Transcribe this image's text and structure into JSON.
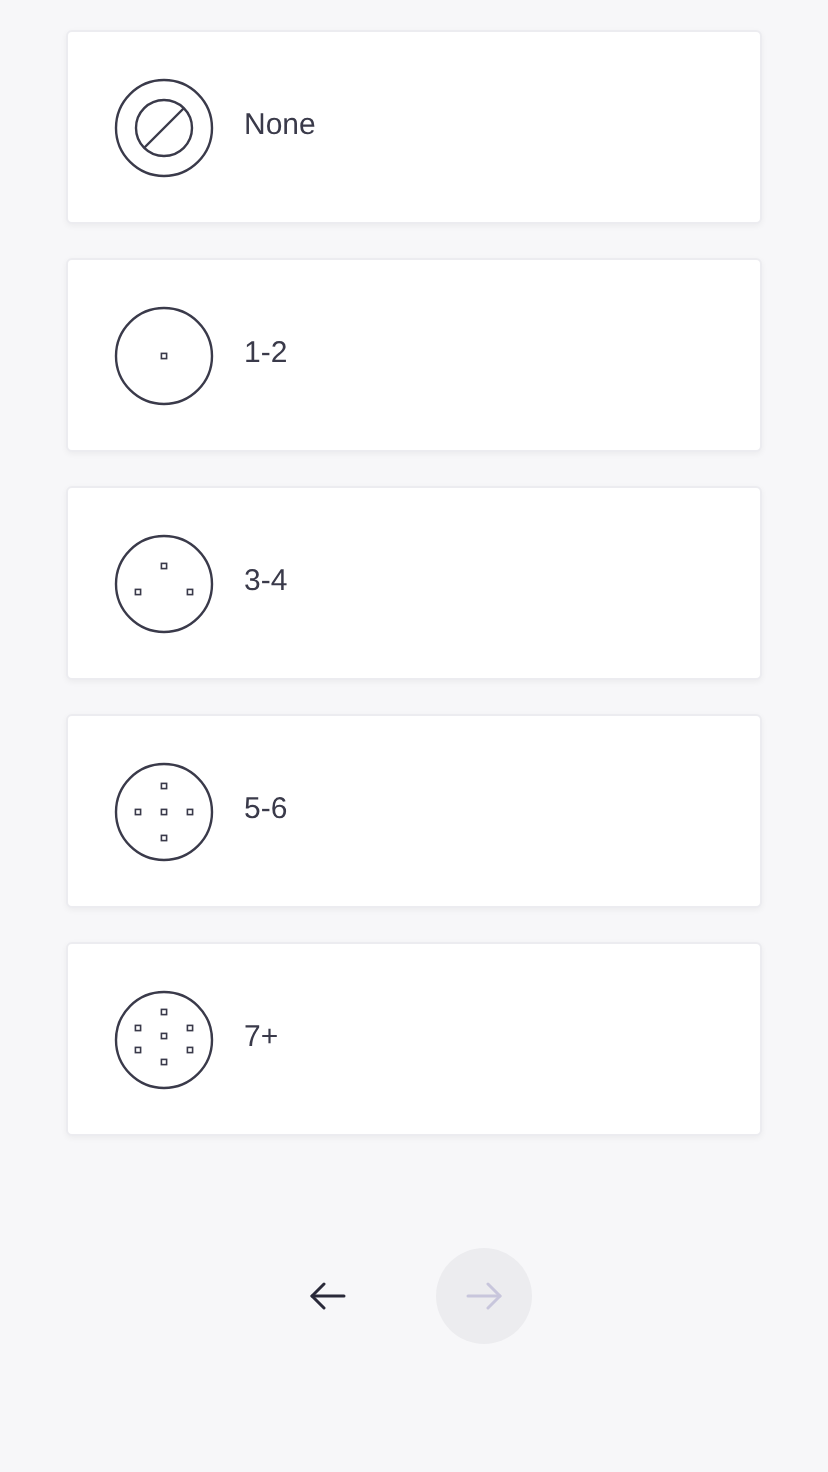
{
  "options": [
    {
      "label": "None",
      "kind": "none"
    },
    {
      "label": "1-2",
      "kind": "one"
    },
    {
      "label": "3-4",
      "kind": "three"
    },
    {
      "label": "5-6",
      "kind": "five"
    },
    {
      "label": "7+",
      "kind": "seven"
    }
  ],
  "navigation": {
    "back": {
      "disabled": false
    },
    "next": {
      "disabled": true
    }
  }
}
